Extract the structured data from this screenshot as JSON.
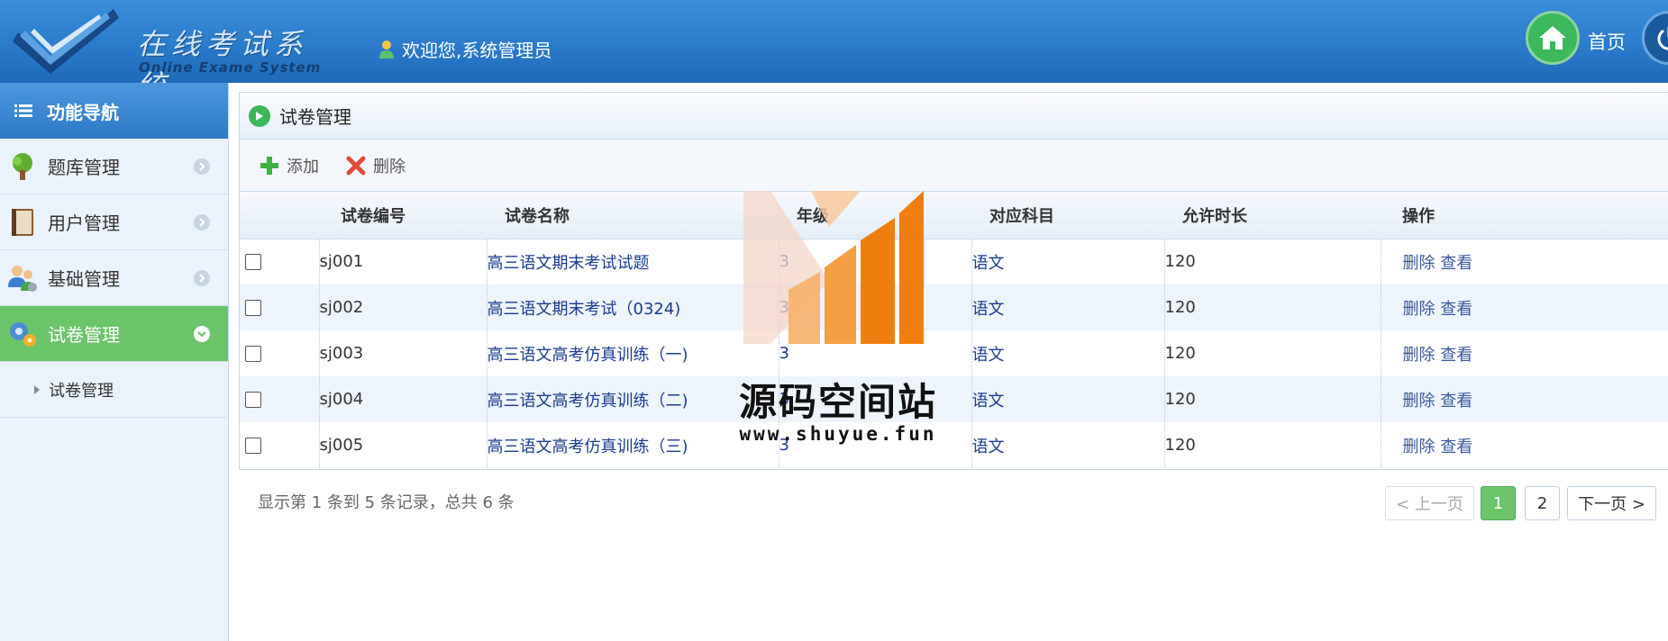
{
  "header": {
    "logo_cn": "在线考试系统",
    "logo_en": "Online Exame System",
    "welcome": "欢迎您,系统管理员",
    "home_label": "首页"
  },
  "sidebar": {
    "title": "功能导航",
    "items": [
      {
        "label": "题库管理",
        "icon": "tree-icon",
        "active": false
      },
      {
        "label": "用户管理",
        "icon": "book-icon",
        "active": false
      },
      {
        "label": "基础管理",
        "icon": "users-icon",
        "active": false
      },
      {
        "label": "试卷管理",
        "icon": "gears-icon",
        "active": true
      }
    ],
    "sub_items": [
      {
        "label": "试卷管理"
      }
    ]
  },
  "panel": {
    "title": "试卷管理",
    "add_label": "添加",
    "delete_label": "删除"
  },
  "table": {
    "columns": [
      "试卷编号",
      "试卷名称",
      "年级",
      "对应科目",
      "允许时长",
      "操作"
    ],
    "rows": [
      {
        "id": "sj001",
        "name": "高三语文期末考试试题",
        "grade": "3",
        "subject": "语文",
        "duration": "120",
        "del": "删除",
        "view": "查看"
      },
      {
        "id": "sj002",
        "name": "高三语文期末考试（0324)",
        "grade": "3",
        "subject": "语文",
        "duration": "120",
        "del": "删除",
        "view": "查看"
      },
      {
        "id": "sj003",
        "name": "高三语文高考仿真训练（一)",
        "grade": "3",
        "subject": "语文",
        "duration": "120",
        "del": "删除",
        "view": "查看"
      },
      {
        "id": "sj004",
        "name": "高三语文高考仿真训练（二)",
        "grade": "3",
        "subject": "语文",
        "duration": "120",
        "del": "删除",
        "view": "查看"
      },
      {
        "id": "sj005",
        "name": "高三语文高考仿真训练（三)",
        "grade": "3",
        "subject": "语文",
        "duration": "120",
        "del": "删除",
        "view": "查看"
      }
    ]
  },
  "pager": {
    "info": "显示第 1 条到 5 条记录，总共 6 条",
    "prev": "< 上一页",
    "pages": [
      "1",
      "2"
    ],
    "current": "1",
    "next": "下一页 >"
  },
  "watermark": {
    "text": "源码空间站",
    "url": "www.shuyue.fun"
  },
  "colors": {
    "header": "#2b7bcb",
    "active_nav": "#6bc46a",
    "link": "#1a3c8e"
  }
}
